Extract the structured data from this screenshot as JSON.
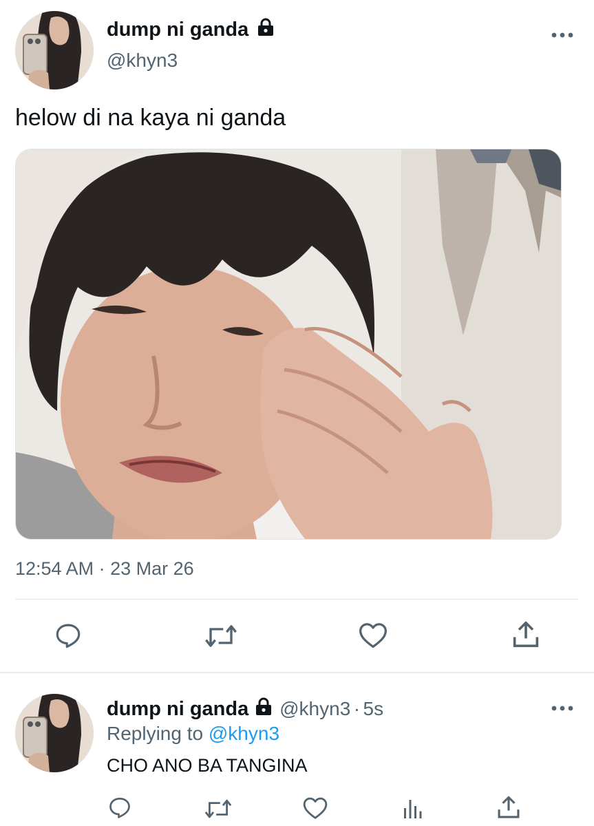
{
  "tweet": {
    "author": {
      "display_name": "dump ni ganda",
      "handle": "@khyn3",
      "locked": true,
      "avatar_icon": "profile-photo"
    },
    "text": "helow di na kaya ni ganda",
    "media": {
      "type": "photo",
      "icon": "crying-person-photo"
    },
    "timestamp": "12:54 AM · 23 Mar 26",
    "actions": [
      "reply",
      "retweet",
      "like",
      "share"
    ],
    "more_icon": "more-horizontal"
  },
  "reply": {
    "author": {
      "display_name": "dump ni ganda",
      "handle": "@khyn3",
      "locked": true
    },
    "separator": "·",
    "time": "5s",
    "replying_to_label": "Replying to",
    "replying_to_handle": "@khyn3",
    "text": "CHO ANO BA TANGINA",
    "actions": [
      "reply",
      "retweet",
      "like",
      "analytics",
      "share"
    ]
  },
  "colors": {
    "text_primary": "#0f1419",
    "text_secondary": "#536471",
    "link": "#1d9bf0",
    "icon": "#536471",
    "divider": "#e4e8eb"
  }
}
